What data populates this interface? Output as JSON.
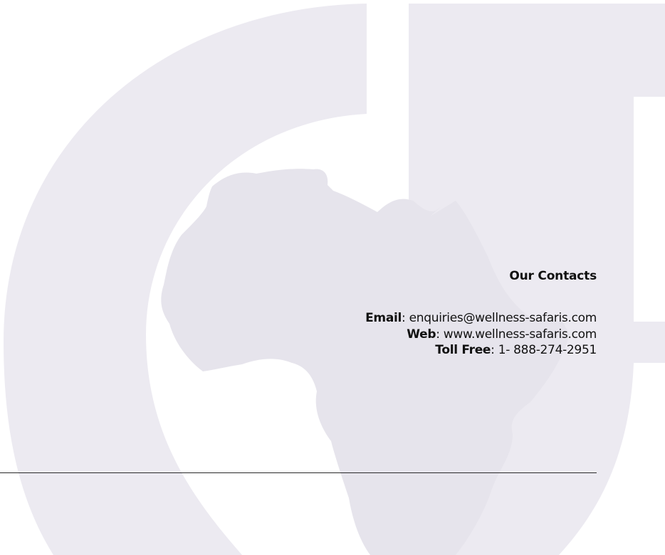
{
  "contacts": {
    "heading": "Our Contacts",
    "email": {
      "label": "Email",
      "separator": ": ",
      "value": "enquiries@wellness-safaris.com"
    },
    "web": {
      "label": "Web",
      "separator": ": ",
      "value": "www.wellness-safaris.com"
    },
    "toll_free": {
      "label": "Toll Free",
      "separator": ": ",
      "value": "1- 888-274-2951"
    }
  },
  "colors": {
    "background": "#ffffff",
    "watermark": "#eceaf1",
    "text": "#111111",
    "rule": "#2a2a2a"
  },
  "icons": {
    "watermark_logo": "company-logo-mark",
    "map": "africa-map"
  }
}
